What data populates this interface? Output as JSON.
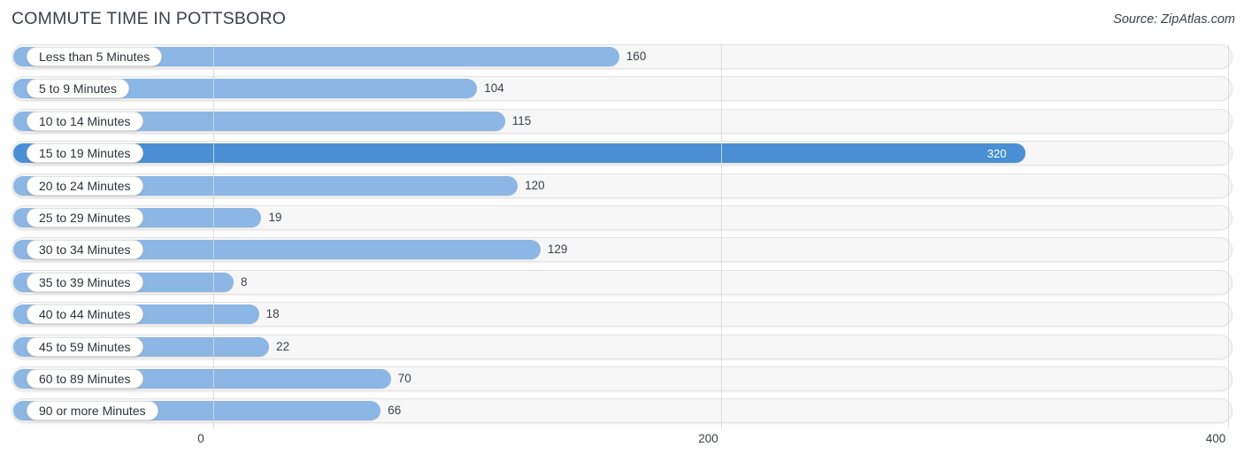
{
  "header": {
    "title": "COMMUTE TIME IN POTTSBORO",
    "source": "Source: ZipAtlas.com"
  },
  "colors": {
    "bar": "#8cb6e4",
    "bar_max": "#4a8fd4",
    "track": "#f7f7f7",
    "track_border": "#e3e3e3",
    "grid": "#d8d8d8",
    "text": "#3c4148",
    "pill_bg": "#ffffff"
  },
  "axis": {
    "ticks": [
      {
        "label": "0",
        "value": 0
      },
      {
        "label": "200",
        "value": 200
      },
      {
        "label": "400",
        "value": 400
      }
    ],
    "min": 0,
    "max": 400
  },
  "chart_data": {
    "type": "bar",
    "orientation": "horizontal",
    "title": "COMMUTE TIME IN POTTSBORO",
    "subtitle": "",
    "xlabel": "",
    "ylabel": "",
    "xlim": [
      0,
      400
    ],
    "grid": true,
    "legend": null,
    "source": "Source: ZipAtlas.com",
    "categories": [
      "Less than 5 Minutes",
      "5 to 9 Minutes",
      "10 to 14 Minutes",
      "15 to 19 Minutes",
      "20 to 24 Minutes",
      "25 to 29 Minutes",
      "30 to 34 Minutes",
      "35 to 39 Minutes",
      "40 to 44 Minutes",
      "45 to 59 Minutes",
      "60 to 89 Minutes",
      "90 or more Minutes"
    ],
    "values": [
      160,
      104,
      115,
      320,
      120,
      19,
      129,
      8,
      18,
      22,
      70,
      66
    ],
    "value_labels": [
      "160",
      "104",
      "115",
      "320",
      "120",
      "19",
      "129",
      "8",
      "18",
      "22",
      "70",
      "66"
    ],
    "highlight_index": 3
  }
}
